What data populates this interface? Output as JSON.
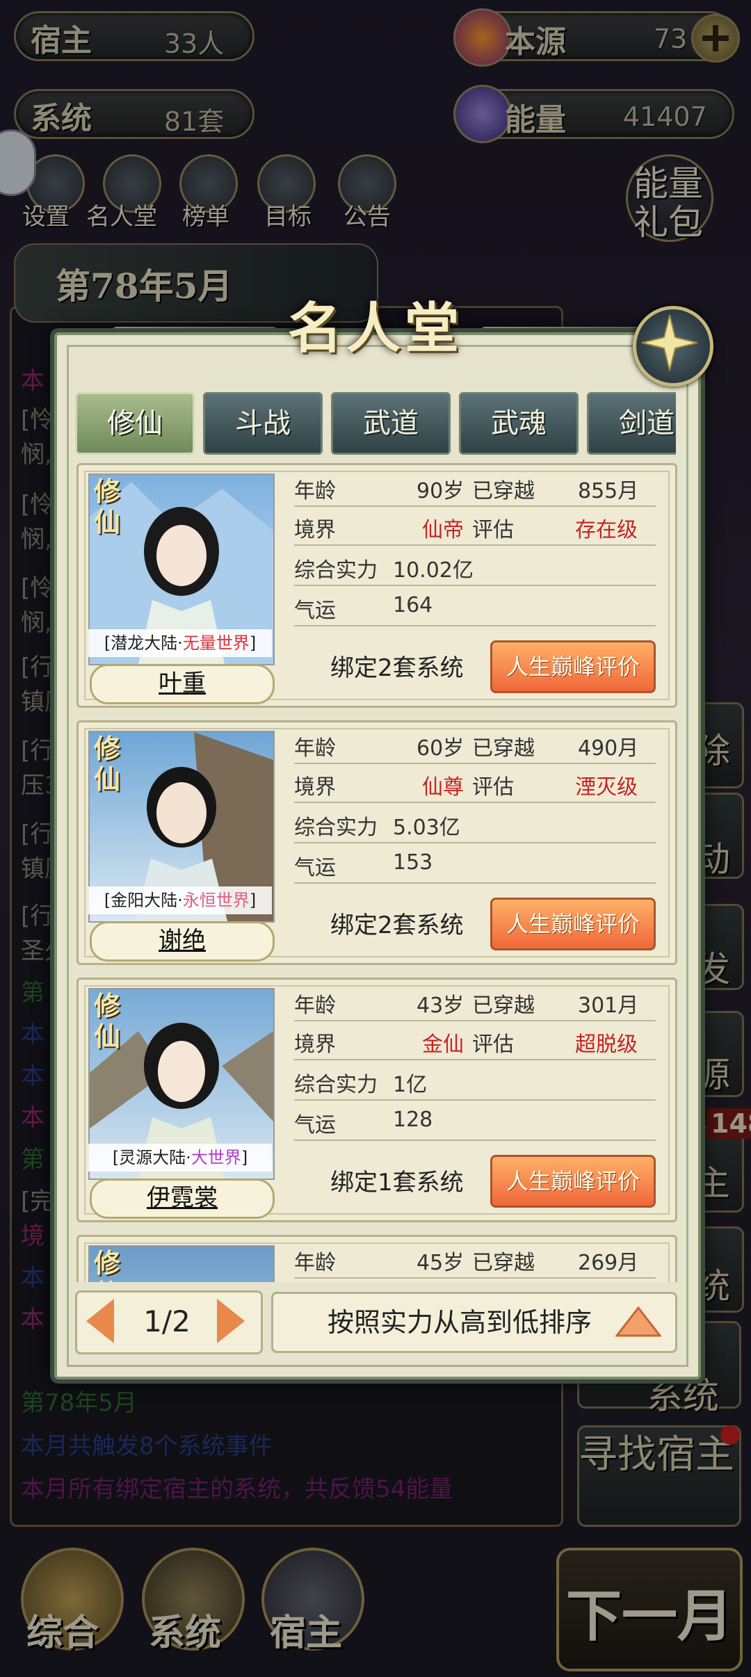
{
  "hud": {
    "host_label": "宿主",
    "host_value": "33人",
    "system_label": "系统",
    "system_value": "81套",
    "source_label": "本源",
    "source_value": "73",
    "energy_label": "能量",
    "energy_value": "41407",
    "menu": [
      "设置",
      "名人堂",
      "榜单",
      "目标",
      "公告"
    ],
    "energy_pack": "能量礼包"
  },
  "log": {
    "date": "第78年5月",
    "lines": [
      {
        "text": "本",
        "color": "#9a2a6a"
      },
      {
        "text": "[怜",
        "color": "#8c8a7a"
      },
      {
        "text": "悯,",
        "color": "#8c8a7a"
      },
      {
        "text": "[怜",
        "color": "#8c8a7a"
      },
      {
        "text": "悯,",
        "color": "#8c8a7a"
      },
      {
        "text": "[怜",
        "color": "#8c8a7a"
      },
      {
        "text": "悯,",
        "color": "#8c8a7a"
      },
      {
        "text": "[行",
        "color": "#8c8a7a"
      },
      {
        "text": "镇压",
        "color": "#8c8a7a"
      },
      {
        "text": "[行",
        "color": "#8c8a7a"
      },
      {
        "text": "压3",
        "color": "#8c8a7a"
      },
      {
        "text": "[行",
        "color": "#8c8a7a"
      },
      {
        "text": "镇压",
        "color": "#8c8a7a"
      },
      {
        "text": "[行",
        "color": "#8c8a7a"
      },
      {
        "text": "圣久",
        "color": "#8c8a7a"
      },
      {
        "text": "第",
        "color": "#2e6a2e"
      },
      {
        "text": "本",
        "color": "#2a3e86"
      },
      {
        "text": "本",
        "color": "#2a3e86"
      },
      {
        "text": "本",
        "color": "#9a2a6a"
      },
      {
        "text": "第",
        "color": "#2e6a2e"
      },
      {
        "text": "[完",
        "color": "#8c8a7a"
      },
      {
        "text": "境",
        "color": "#9a2a6a"
      },
      {
        "text": "本",
        "color": "#2a3e86"
      },
      {
        "text": "本",
        "color": "#9a2a6a"
      }
    ],
    "footer_date": "第78年5月",
    "footer_events": "本月共触发8个系统事件",
    "footer_feedback": "本月所有绑定宿主的系统，共反馈54能量"
  },
  "side_buttons": [
    "除",
    "动",
    "发",
    "源",
    "主",
    "统",
    "系统",
    "寻找宿主"
  ],
  "side_badge": "148",
  "bottom_nav": [
    "综合",
    "系统",
    "宿主"
  ],
  "next_month": "下一月",
  "modal": {
    "title": "名人堂",
    "tabs": [
      "修仙",
      "斗战",
      "武道",
      "武魂",
      "剑道"
    ],
    "labels": {
      "age": "年龄",
      "crossed": "已穿越",
      "realm": "境界",
      "evaluation": "评估",
      "power": "综合实力",
      "luck": "气运",
      "peak_button": "人生巅峰评价"
    },
    "cards": [
      {
        "badge": "修仙",
        "world_prefix": "[潜龙大陆·",
        "world_name": "无量世界",
        "world_suffix": "]",
        "world_color": "#e0303a",
        "name": "叶重",
        "age": "90岁",
        "crossed": "855月",
        "realm": "仙帝",
        "evaluation": "存在级",
        "power": "10.02亿",
        "luck": "164",
        "bind": "绑定2套系统"
      },
      {
        "badge": "修仙",
        "world_prefix": "[金阳大陆·",
        "world_name": "永恒世界",
        "world_suffix": "]",
        "world_color": "#e25c86",
        "name": "谢绝",
        "age": "60岁",
        "crossed": "490月",
        "realm": "仙尊",
        "evaluation": "湮灭级",
        "power": "5.03亿",
        "luck": "153",
        "bind": "绑定2套系统"
      },
      {
        "badge": "修仙",
        "world_prefix": "[灵源大陆·",
        "world_name": "大世界",
        "world_suffix": "]",
        "world_color": "#b23ad0",
        "name": "伊霓裳",
        "age": "43岁",
        "crossed": "301月",
        "realm": "金仙",
        "evaluation": "超脱级",
        "power": "1亿",
        "luck": "128",
        "bind": "绑定1套系统"
      },
      {
        "badge": "修仙",
        "age": "45岁",
        "crossed": "269月"
      }
    ],
    "page": "1/2",
    "sort": "按照实力从高到低排序"
  }
}
